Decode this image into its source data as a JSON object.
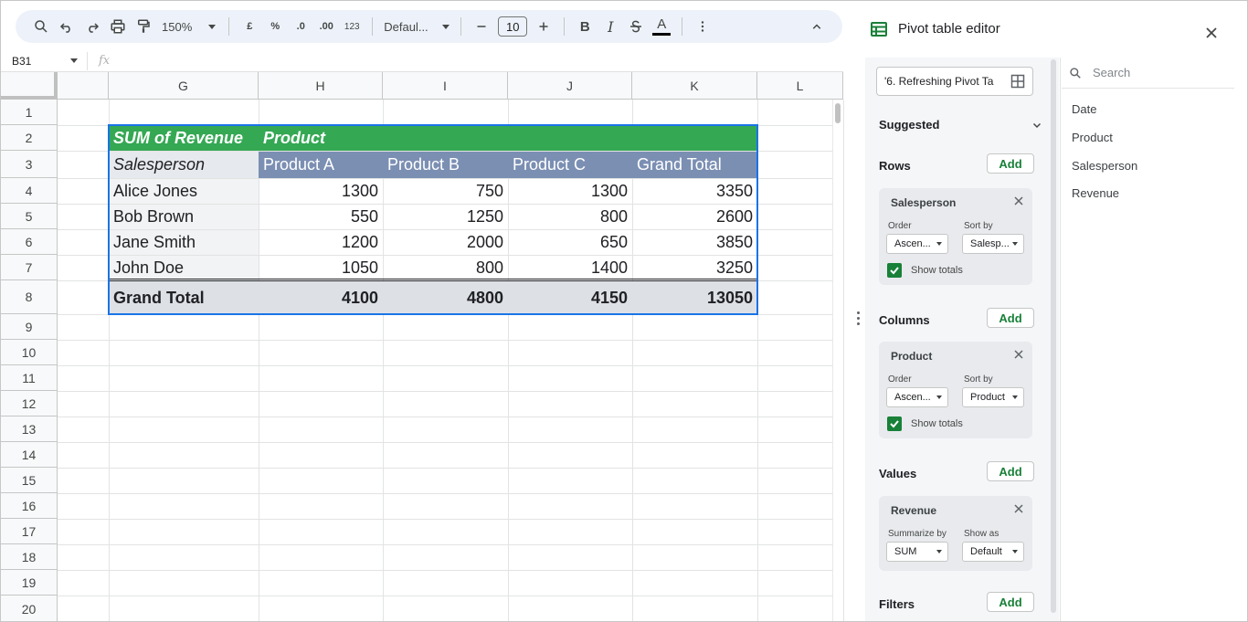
{
  "toolbar": {
    "zoom": "150%",
    "currency_label": "£",
    "percent_label": "%",
    "decrease_decimal_label": ".0",
    "increase_decimal_label": ".00",
    "format_label": "123",
    "font": "Defaul...",
    "font_size": "10",
    "bold_label": "B",
    "italic_label": "I",
    "text_color_label": "A",
    "icons": [
      "search-icon",
      "undo-icon",
      "redo-icon",
      "print-icon",
      "paint-format-icon",
      "chevron-up-icon",
      "more-icon"
    ]
  },
  "formula_bar": {
    "name_box": "B31",
    "fx": "fx"
  },
  "columns": [
    "G",
    "H",
    "I",
    "J",
    "K",
    "L"
  ],
  "rows": [
    "1",
    "2",
    "3",
    "4",
    "5",
    "6",
    "7",
    "8",
    "9",
    "10",
    "11",
    "12",
    "13",
    "14",
    "15",
    "16",
    "17",
    "18",
    "19",
    "20"
  ],
  "pivot": {
    "title": "SUM of Revenue",
    "col_field": "Product",
    "row_field": "Salesperson",
    "headers": [
      "Product A",
      "Product B",
      "Product C",
      "Grand Total"
    ],
    "data": [
      {
        "name": "Alice Jones",
        "values": [
          "1300",
          "750",
          "1300",
          "3350"
        ]
      },
      {
        "name": "Bob Brown",
        "values": [
          "550",
          "1250",
          "800",
          "2600"
        ]
      },
      {
        "name": "Jane Smith",
        "values": [
          "1200",
          "2000",
          "650",
          "3850"
        ]
      },
      {
        "name": "John Doe",
        "values": [
          "1050",
          "800",
          "1400",
          "3250"
        ]
      }
    ],
    "total_label": "Grand Total",
    "totals": [
      "4100",
      "4800",
      "4150",
      "13050"
    ]
  },
  "editor": {
    "title": "Pivot table editor",
    "range": "'6. Refreshing Pivot Ta",
    "suggested": "Suggested",
    "add_label": "Add",
    "rows_title": "Rows",
    "columns_title": "Columns",
    "values_title": "Values",
    "filters_title": "Filters",
    "order_label": "Order",
    "sortby_label": "Sort by",
    "show_totals": "Show totals",
    "rows_card": {
      "field": "Salesperson",
      "order": "Ascen...",
      "sort_by": "Salesp..."
    },
    "columns_card": {
      "field": "Product",
      "order": "Ascen...",
      "sort_by": "Product"
    },
    "values_card": {
      "field": "Revenue",
      "summarize_label": "Summarize by",
      "summarize": "SUM",
      "showas_label": "Show as",
      "show_as": "Default"
    },
    "search_placeholder": "Search",
    "fields": [
      "Date",
      "Product",
      "Salesperson",
      "Revenue"
    ]
  },
  "colors": {
    "pivot_header_green": "#34a853",
    "pivot_subheader_blue": "#7b8fb3",
    "selection_blue": "#1a73e8",
    "checkbox_green": "#188038"
  }
}
